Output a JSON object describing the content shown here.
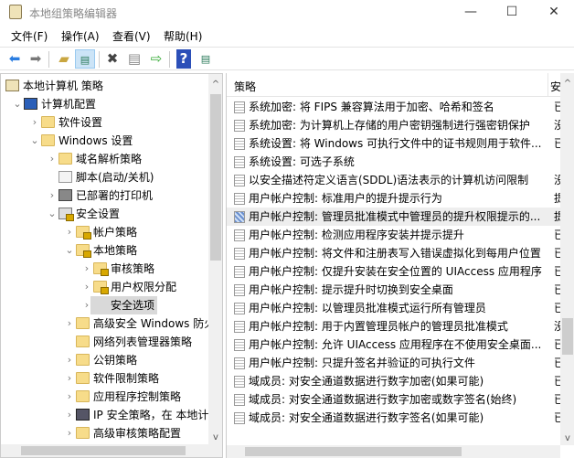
{
  "window": {
    "title": "本地组策略编辑器",
    "minimize": "—",
    "maximize": "☐",
    "close": "✕"
  },
  "menu": [
    "文件(F)",
    "操作(A)",
    "查看(V)",
    "帮助(H)"
  ],
  "toolbar": [
    "back-icon",
    "forward-icon",
    "up-folder-icon",
    "show-hide-tree-icon",
    "delete-icon",
    "properties-icon",
    "export-icon",
    "help-icon",
    "show-action-pane-icon"
  ],
  "tree": [
    {
      "label": "本地计算机 策略",
      "level": 0,
      "exp": "",
      "icon": "scroll"
    },
    {
      "label": "计算机配置",
      "level": 1,
      "exp": "open",
      "icon": "computer"
    },
    {
      "label": "软件设置",
      "level": 2,
      "exp": "closed",
      "icon": "folder"
    },
    {
      "label": "Windows 设置",
      "level": 2,
      "exp": "open",
      "icon": "folder"
    },
    {
      "label": "域名解析策略",
      "level": 3,
      "exp": "closed",
      "icon": "folder"
    },
    {
      "label": "脚本(启动/关机)",
      "level": 3,
      "exp": "",
      "icon": "script"
    },
    {
      "label": "已部署的打印机",
      "level": 3,
      "exp": "closed",
      "icon": "printer"
    },
    {
      "label": "安全设置",
      "level": 3,
      "exp": "open",
      "icon": "security"
    },
    {
      "label": "帐户策略",
      "level": 4,
      "exp": "closed",
      "icon": "lockfolder"
    },
    {
      "label": "本地策略",
      "level": 4,
      "exp": "open",
      "icon": "lockfolder"
    },
    {
      "label": "审核策略",
      "level": 5,
      "exp": "closed",
      "icon": "lockfolder"
    },
    {
      "label": "用户权限分配",
      "level": 5,
      "exp": "closed",
      "icon": "lockfolder"
    },
    {
      "label": "安全选项",
      "level": 5,
      "exp": "closed",
      "icon": "lockfolder",
      "selected": true
    },
    {
      "label": "高级安全 Windows 防火墙",
      "level": 4,
      "exp": "closed",
      "icon": "folder"
    },
    {
      "label": "网络列表管理器策略",
      "level": 4,
      "exp": "",
      "icon": "folder"
    },
    {
      "label": "公钥策略",
      "level": 4,
      "exp": "closed",
      "icon": "folder"
    },
    {
      "label": "软件限制策略",
      "level": 4,
      "exp": "closed",
      "icon": "folder"
    },
    {
      "label": "应用程序控制策略",
      "level": 4,
      "exp": "closed",
      "icon": "folder"
    },
    {
      "label": "IP 安全策略，在 本地计算机",
      "level": 4,
      "exp": "closed",
      "icon": "ipsec"
    },
    {
      "label": "高级审核策略配置",
      "level": 4,
      "exp": "closed",
      "icon": "folder"
    }
  ],
  "list": {
    "col_policy": "策略",
    "col_setting": "安全设置",
    "rows": [
      {
        "p": "系统加密: 将 FIPS 兼容算法用于加密、哈希和签名",
        "v": "已禁用"
      },
      {
        "p": "系统加密: 为计算机上存储的用户密钥强制进行强密钥保护",
        "v": "没有定义"
      },
      {
        "p": "系统设置: 将 Windows 可执行文件中的证书规则用于软件...",
        "v": "已禁用"
      },
      {
        "p": "系统设置: 可选子系统",
        "v": ""
      },
      {
        "p": "以安全描述符定义语言(SDDL)语法表示的计算机访问限制",
        "v": "没有定义"
      },
      {
        "p": "用户帐户控制: 标准用户的提升提示行为",
        "v": "提示凭据"
      },
      {
        "p": "用户帐户控制: 管理员批准模式中管理员的提升权限提示的...",
        "v": "提示同意",
        "highlight": true
      },
      {
        "p": "用户帐户控制: 检测应用程序安装并提示提升",
        "v": "已启用"
      },
      {
        "p": "用户帐户控制: 将文件和注册表写入错误虚拟化到每用户位置",
        "v": "已启用"
      },
      {
        "p": "用户帐户控制: 仅提升安装在安全位置的 UIAccess 应用程序",
        "v": "已启用"
      },
      {
        "p": "用户帐户控制: 提示提升时切换到安全桌面",
        "v": "已启用"
      },
      {
        "p": "用户帐户控制: 以管理员批准模式运行所有管理员",
        "v": "已启用"
      },
      {
        "p": "用户帐户控制: 用于内置管理员帐户的管理员批准模式",
        "v": "没有定义"
      },
      {
        "p": "用户帐户控制: 允许 UIAccess 应用程序在不使用安全桌面...",
        "v": "已禁用"
      },
      {
        "p": "用户帐户控制: 只提升签名并验证的可执行文件",
        "v": "已禁用"
      },
      {
        "p": "域成员: 对安全通道数据进行数字加密(如果可能)",
        "v": "已启用"
      },
      {
        "p": "域成员: 对安全通道数据进行数字加密或数字签名(始终)",
        "v": "已启用"
      },
      {
        "p": "域成员: 对安全通道数据进行数字签名(如果可能)",
        "v": "已启用"
      }
    ]
  }
}
